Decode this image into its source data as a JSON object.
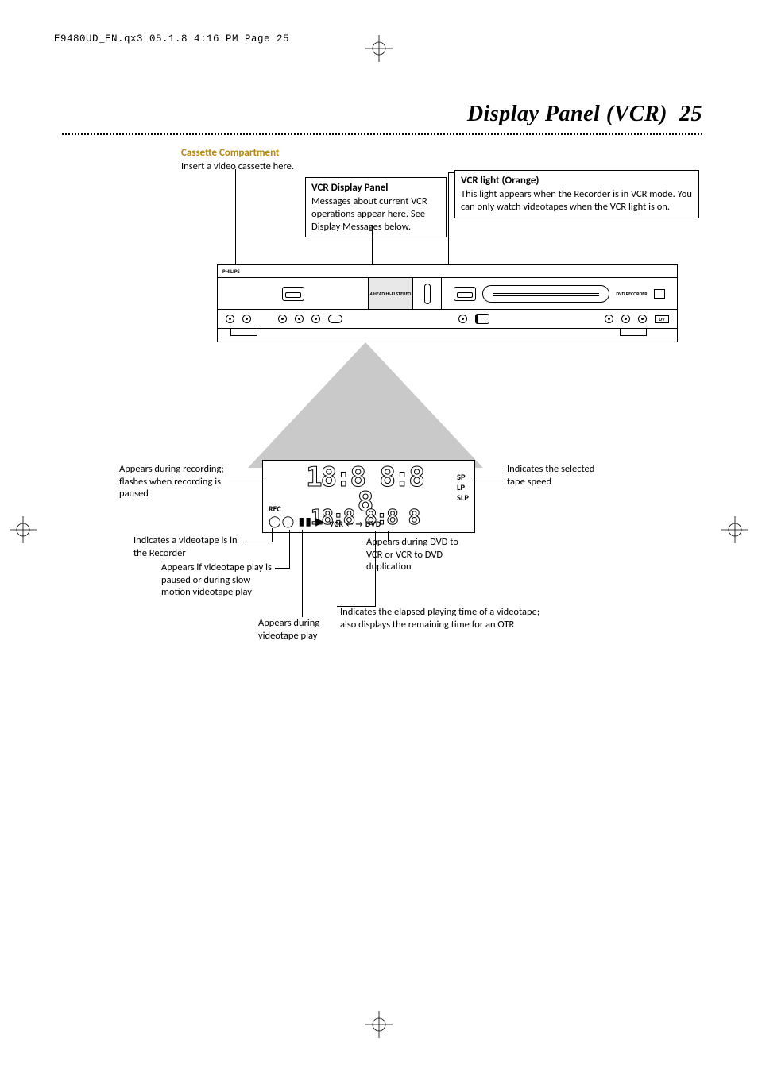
{
  "page": {
    "header_meta": "E9480UD_EN.qx3  05.1.8  4:16 PM  Page 25",
    "title": "Display Panel (VCR)",
    "number": "25"
  },
  "callouts": {
    "cassette": {
      "heading": "Cassette Compartment",
      "body": "Insert a video cassette here."
    },
    "vcr_panel": {
      "heading": "VCR Display Panel",
      "body": "Messages about current VCR operations appear here. See Display Messages below."
    },
    "vcr_light": {
      "heading": "VCR light (Orange)",
      "body": "This light appears when the Recorder is in VCR mode. You can only watch videotapes when the VCR light is on."
    },
    "rec": "Appears during recording; flashes when recording is paused",
    "speed": "Indicates the selected tape speed",
    "tape_in": "Indicates a videotape is in the Recorder",
    "pause": "Appears if videotape play is paused or during slow motion videotape play",
    "play": "Appears during videotape play",
    "dup": "Appears during DVD to VCR or VCR to DVD duplication",
    "elapsed": "Indicates the elapsed playing time of a videotape; also displays the remaining time for an OTR"
  },
  "device": {
    "brand": "PHILIPS",
    "center_label": "4 HEAD HI-FI STEREO",
    "right_label": "DVD RECORDER",
    "dv_port": "DV"
  },
  "panel": {
    "rec": "REC",
    "icons": "◯◯ ▮▮ ▶",
    "speeds": [
      "SP",
      "LP",
      "SLP"
    ],
    "segment_digits": "18:8 8:8 8",
    "vcrdvd": "VCR ← → DVD"
  }
}
